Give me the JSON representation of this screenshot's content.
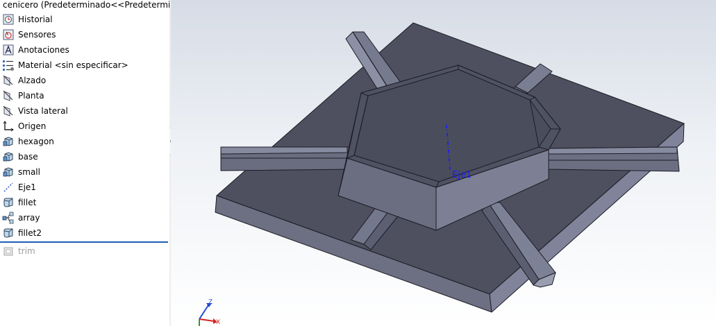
{
  "feature_tree": {
    "title": "cenicero  (Predeterminado<<Predeterminado",
    "items": [
      {
        "label": "Historial",
        "icon": "history-icon"
      },
      {
        "label": "Sensores",
        "icon": "sensor-icon"
      },
      {
        "label": "Anotaciones",
        "icon": "annotations-icon"
      },
      {
        "label": "Material <sin especificar>",
        "icon": "material-icon"
      },
      {
        "label": "Alzado",
        "icon": "plane-icon"
      },
      {
        "label": "Planta",
        "icon": "plane-icon"
      },
      {
        "label": "Vista lateral",
        "icon": "plane-icon"
      },
      {
        "label": "Origen",
        "icon": "origin-icon"
      },
      {
        "label": "hexagon",
        "icon": "extrude-icon"
      },
      {
        "label": "base",
        "icon": "extrude-icon"
      },
      {
        "label": "small",
        "icon": "extrude-icon"
      },
      {
        "label": "Eje1",
        "icon": "axis-icon"
      },
      {
        "label": "fillet",
        "icon": "fillet-icon"
      },
      {
        "label": "array",
        "icon": "pattern-icon"
      },
      {
        "label": "fillet2",
        "icon": "fillet-icon"
      }
    ],
    "suppressed_item": {
      "label": "trim",
      "icon": "cut-icon"
    }
  },
  "viewport": {
    "axis_label": "Eje1",
    "triad": {
      "z": "Z",
      "x": "X"
    },
    "axis_color": "#1a1aff",
    "model_color": "#5f6272"
  }
}
